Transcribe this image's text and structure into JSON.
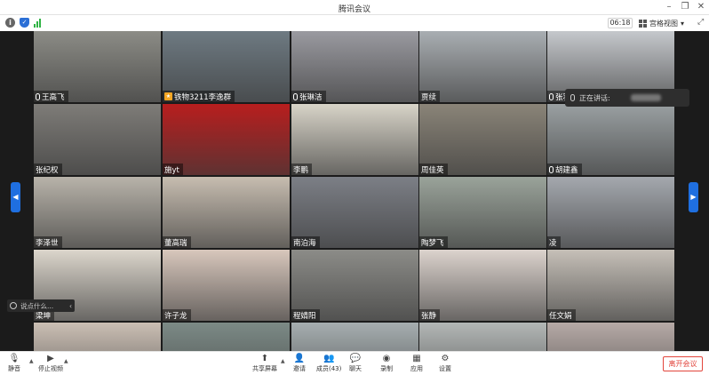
{
  "window": {
    "title": "腾讯会议"
  },
  "header": {
    "clock": "06:18",
    "view_label": "宫格视图"
  },
  "speaking": {
    "label": "正在讲话:"
  },
  "chat": {
    "placeholder": "说点什么..."
  },
  "participants": [
    {
      "name": "王高飞",
      "icon": "mic-icon",
      "bg": "#8c8c86"
    },
    {
      "name": "铁物3211李逸群",
      "icon": "host-icon",
      "bg": "#6e7a82"
    },
    {
      "name": "张琳洁",
      "icon": "mic-icon",
      "bg": "#9a9aa0"
    },
    {
      "name": "贾续",
      "icon": "",
      "bg": "#a9aeb2"
    },
    {
      "name": "张羽翔",
      "icon": "mic-icon",
      "bg": "#c5c8cc"
    },
    {
      "name": "张纪权",
      "icon": "",
      "bg": "#7e7c78"
    },
    {
      "name": "施yt",
      "icon": "",
      "bg": "#b81e1e"
    },
    {
      "name": "李鹏",
      "icon": "",
      "bg": "#d8d4c8"
    },
    {
      "name": "周佳英",
      "icon": "",
      "bg": "#8a8478"
    },
    {
      "name": "胡建鑫",
      "icon": "mic-icon",
      "bg": "#9aa0a2"
    },
    {
      "name": "李泽世",
      "icon": "",
      "bg": "#b8b3aa"
    },
    {
      "name": "董高瑞",
      "icon": "",
      "bg": "#c7bdb0"
    },
    {
      "name": "南泊海",
      "icon": "",
      "bg": "#7c7f86"
    },
    {
      "name": "陶梦飞",
      "icon": "",
      "bg": "#9aa39a"
    },
    {
      "name": "凌",
      "icon": "",
      "bg": "#a4a8ae"
    },
    {
      "name": "梁坤",
      "icon": "",
      "bg": "#dcd6cc"
    },
    {
      "name": "许子龙",
      "icon": "",
      "bg": "#d8c7bc"
    },
    {
      "name": "程婧阳",
      "icon": "",
      "bg": "#8c8c88"
    },
    {
      "name": "张静",
      "icon": "",
      "bg": "#dcd3cd"
    },
    {
      "name": "任文娟",
      "icon": "",
      "bg": "#c6c0b8"
    },
    {
      "name": "",
      "icon": "",
      "bg": "#cbbfb4"
    },
    {
      "name": "",
      "icon": "",
      "bg": "#7c8a86"
    },
    {
      "name": "",
      "icon": "",
      "bg": "#a6aeb0"
    },
    {
      "name": "",
      "icon": "",
      "bg": "#b3b7b6"
    },
    {
      "name": "",
      "icon": "",
      "bg": "#b6aaa6"
    }
  ],
  "toolbar": {
    "mute": "静音",
    "stop_video": "停止视频",
    "share": "共享屏幕",
    "invite": "邀请",
    "members": "成员(43)",
    "chat": "聊天",
    "record": "录制",
    "apps": "应用",
    "settings": "设置",
    "leave": "离开会议"
  },
  "colors": {
    "accent": "#1f6fe0",
    "leave": "#e2453c"
  }
}
